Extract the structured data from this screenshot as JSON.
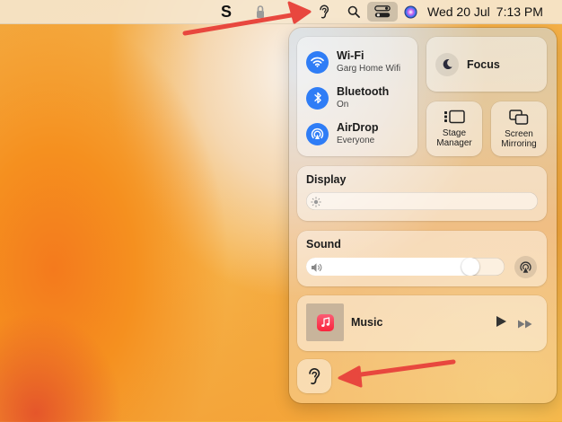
{
  "menubar": {
    "app_letter": "S",
    "date": "Wed 20 Jul",
    "time": "7:13 PM"
  },
  "control_center": {
    "wifi": {
      "label": "Wi-Fi",
      "status": "Garg Home Wifi"
    },
    "bluetooth": {
      "label": "Bluetooth",
      "status": "On"
    },
    "airdrop": {
      "label": "AirDrop",
      "status": "Everyone"
    },
    "focus": {
      "label": "Focus"
    },
    "stage_manager": {
      "label": "Stage\nManager"
    },
    "screen_mirroring": {
      "label": "Screen\nMirroring"
    },
    "display": {
      "title": "Display",
      "brightness": 0.0
    },
    "sound": {
      "title": "Sound",
      "volume": 0.86
    },
    "music": {
      "label": "Music"
    }
  },
  "colors": {
    "accent_blue": "#2f7df6",
    "arrow_red": "#e8473e",
    "music_icon": "#fa243c"
  },
  "icons": [
    "hearing-icon",
    "search-icon",
    "control-center-icon",
    "siri-icon",
    "wifi-icon",
    "bluetooth-icon",
    "airdrop-icon",
    "moon-icon",
    "stage-manager-icon",
    "screen-mirroring-icon",
    "sun-icon",
    "speaker-icon",
    "airplay-audio-icon",
    "music-app-icon",
    "play-icon",
    "forward-icon"
  ]
}
